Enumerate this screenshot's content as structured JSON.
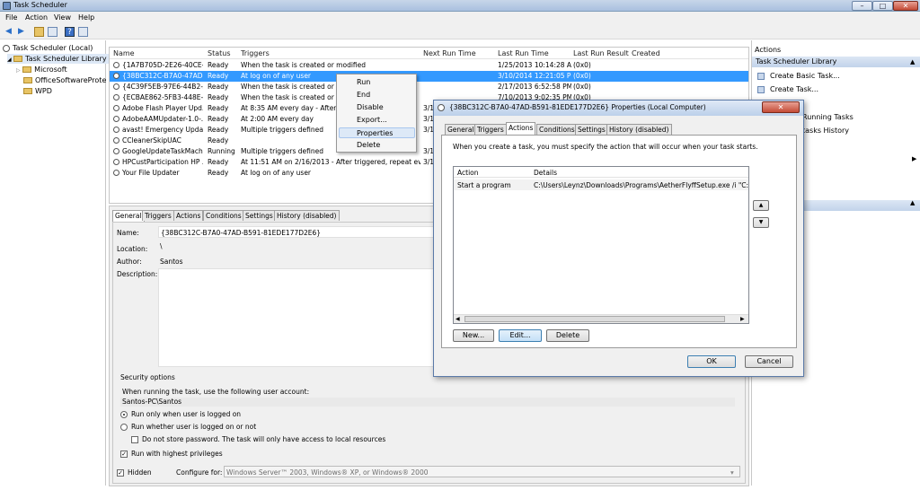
{
  "window": {
    "title": "Task Scheduler",
    "min": "–",
    "max": "□",
    "close": "✕"
  },
  "menu": [
    "File",
    "Action",
    "View",
    "Help"
  ],
  "tree": {
    "root": "Task Scheduler (Local)",
    "library": "Task Scheduler Library",
    "folders": [
      "Microsoft",
      "OfficeSoftwareProtect",
      "WPD"
    ]
  },
  "tasklist": {
    "columns": [
      "Name",
      "Status",
      "Triggers",
      "Next Run Time",
      "Last Run Time",
      "Last Run Result",
      "Created"
    ],
    "rows": [
      {
        "name": "{1A7B705D-2E26-40CE-A...",
        "status": "Ready",
        "triggers": "When the task is created or modified",
        "next": "",
        "last": "1/25/2013 10:14:28 AM",
        "result": "(0x0)"
      },
      {
        "name": "{38BC312C-B7A0-47AD-...",
        "status": "Ready",
        "triggers": "At log on of any user",
        "next": "",
        "last": "3/10/2014 12:21:05 PM",
        "result": "(0x0)"
      },
      {
        "name": "{4C39F5EB-97E6-44B2-A...",
        "status": "Ready",
        "triggers": "When the task is created or moc",
        "next": "",
        "last": "2/17/2013 6:52:58 PM",
        "result": "(0x0)"
      },
      {
        "name": "{ECBAE862-5FB3-448E-A...",
        "status": "Ready",
        "triggers": "When the task is created or moc",
        "next": "",
        "last": "7/10/2013 9:02:35 PM",
        "result": "(0x0)"
      },
      {
        "name": "Adobe Flash Player Upd...",
        "status": "Ready",
        "triggers": "At 8:35 AM every day - After trig",
        "next": "3/1",
        "last": "",
        "result": ""
      },
      {
        "name": "AdobeAAMUpdater-1.0-...",
        "status": "Ready",
        "triggers": "At 2:00 AM every day",
        "next": "3/1",
        "last": "",
        "result": ""
      },
      {
        "name": "avast! Emergency Update",
        "status": "Ready",
        "triggers": "Multiple triggers defined",
        "next": "3/1",
        "last": "",
        "result": ""
      },
      {
        "name": "CCleanerSkipUAC",
        "status": "Ready",
        "triggers": "",
        "next": "",
        "last": "",
        "result": ""
      },
      {
        "name": "GoogleUpdateTaskMach...",
        "status": "Running",
        "triggers": "Multiple triggers defined",
        "next": "3/1",
        "last": "",
        "result": ""
      },
      {
        "name": "HPCustParticipation HP ...",
        "status": "Ready",
        "triggers": "At 11:51 AM on 2/16/2013 - After triggered, repeat every ...",
        "next": "3/1",
        "last": "",
        "result": ""
      },
      {
        "name": "Your File Updater",
        "status": "Ready",
        "triggers": "At log on of any user",
        "next": "",
        "last": "",
        "result": ""
      }
    ]
  },
  "context_menu": [
    "Run",
    "End",
    "Disable",
    "Export...",
    "Properties",
    "Delete"
  ],
  "details": {
    "tabs": [
      "General",
      "Triggers",
      "Actions",
      "Conditions",
      "Settings",
      "History (disabled)"
    ],
    "name_label": "Name:",
    "name_value": "{38BC312C-B7A0-47AD-B591-81EDE177D2E6}",
    "location_label": "Location:",
    "location_value": "\\",
    "author_label": "Author:",
    "author_value": "Santos",
    "description_label": "Description:",
    "security_title": "Security options",
    "account_prompt": "When running the task, use the following user account:",
    "account_value": "Santos-PC\\Santos",
    "opt_logged_on": "Run only when user is logged on",
    "opt_whether": "Run whether user is logged on or not",
    "opt_no_store": "Do not store password.  The task will only have access to local resources",
    "opt_highest": "Run with highest privileges",
    "hidden_label": "Hidden",
    "configure_label": "Configure for:",
    "configure_value": "Windows Server™ 2003, Windows® XP, or Windows® 2000"
  },
  "actions_pane": {
    "header": "Actions",
    "section": "Task Scheduler Library",
    "items": [
      "Create Basic Task...",
      "Create Task...",
      "Running Tasks",
      "tasks History"
    ]
  },
  "dialog": {
    "title": "{38BC312C-B7A0-47AD-B591-81EDE177D2E6} Properties (Local Computer)",
    "tabs": [
      "General",
      "Triggers",
      "Actions",
      "Conditions",
      "Settings",
      "History (disabled)"
    ],
    "instruction": "When you create a task, you must specify the action that will occur when your task starts.",
    "col_action": "Action",
    "col_details": "Details",
    "row_action": "Start a program",
    "row_details": "C:\\Users\\Leynz\\Downloads\\Programs\\AetherFlyffSetup.exe /i \"C:\\Users\\",
    "btn_new": "New...",
    "btn_edit": "Edit...",
    "btn_delete": "Delete",
    "btn_ok": "OK",
    "btn_cancel": "Cancel"
  }
}
